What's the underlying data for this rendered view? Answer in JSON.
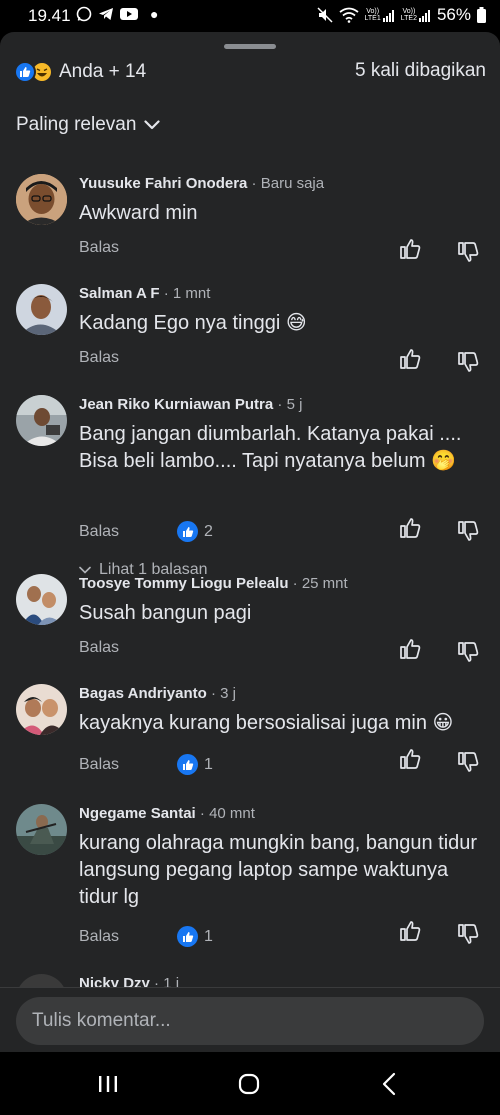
{
  "status_bar": {
    "time": "19.41",
    "battery": "56%",
    "lte1": "LTE1",
    "lte2": "LTE2",
    "volte": "Vo))"
  },
  "summary": {
    "reactors": "Anda + 14",
    "shares": "5 kali dibagikan"
  },
  "sort": {
    "label": "Paling relevan"
  },
  "comments": [
    {
      "name": "Yuusuke Fahri Onodera",
      "time": "Baru saja",
      "text": "Awkward min",
      "reply_label": "Balas",
      "likes": ""
    },
    {
      "name": "Salman A F",
      "time": "1 mnt",
      "text": "Kadang Ego nya tinggi",
      "emoji": "😅",
      "reply_label": "Balas",
      "likes": ""
    },
    {
      "name": "Jean Riko Kurniawan Putra",
      "time": "5 j",
      "text": "Bang jangan diumbarlah. Katanya pakai .... Bisa beli lambo.... Tapi nyatanya belum",
      "emoji": "🤭",
      "reply_label": "Balas",
      "likes": "2",
      "replies_label": "Lihat 1 balasan"
    },
    {
      "name": "Toosye Tommy Liogu Pelealu",
      "time": "25 mnt",
      "text": "Susah bangun pagi",
      "reply_label": "Balas",
      "likes": ""
    },
    {
      "name": "Bagas Andriyanto",
      "time": "3 j",
      "text": "kayaknya kurang bersosialisai juga min",
      "emoji": "😀",
      "reply_label": "Balas",
      "likes": "1"
    },
    {
      "name": "Ngegame Santai",
      "time": "40 mnt",
      "text": "kurang olahraga mungkin bang, bangun tidur langsung pegang laptop sampe waktunya tidur lg",
      "reply_label": "Balas",
      "likes": "1"
    },
    {
      "name": "Nicky Dzy",
      "time": "1 j"
    }
  ],
  "composer": {
    "placeholder": "Tulis komentar..."
  },
  "colors": {
    "sheet_bg": "#242526",
    "like_blue": "#1877f2",
    "text_primary": "#e4e6eb",
    "text_secondary": "#b0b3b8"
  }
}
